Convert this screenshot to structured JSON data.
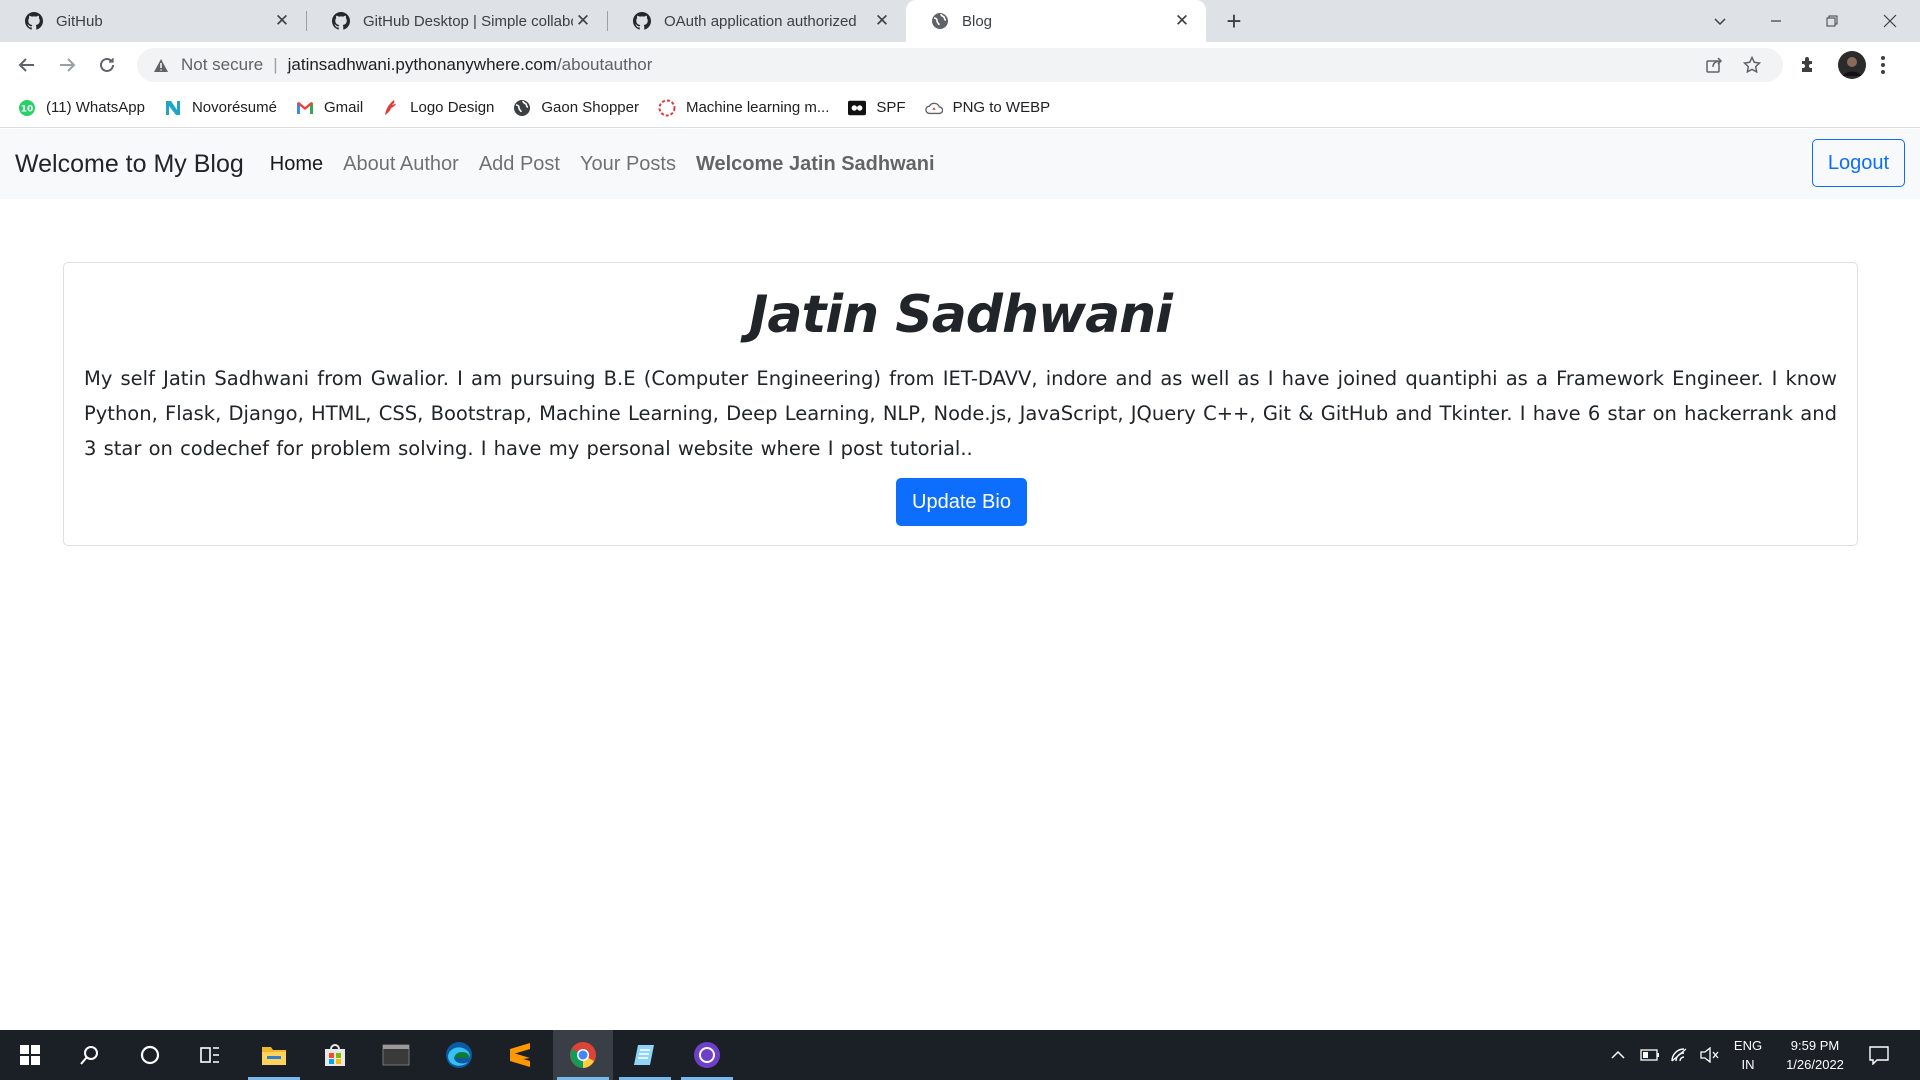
{
  "browser": {
    "tabs": [
      {
        "title": "GitHub",
        "icon": "github-icon",
        "active": false
      },
      {
        "title": "GitHub Desktop | Simple collabor",
        "icon": "github-icon",
        "active": false
      },
      {
        "title": "OAuth application authorized",
        "icon": "github-icon",
        "active": false
      },
      {
        "title": "Blog",
        "icon": "globe-icon",
        "active": true
      }
    ],
    "close_glyph": "✕",
    "new_tab_glyph": "+",
    "address": {
      "security_label": "Not secure",
      "separator": "|",
      "host": "jatinsadhwani.pythonanywhere.com",
      "path": "/aboutauthor"
    },
    "bookmarks": [
      {
        "label": "(11) WhatsApp",
        "icon": "whatsapp-icon"
      },
      {
        "label": "Novorésumé",
        "icon": "novoresume-icon"
      },
      {
        "label": "Gmail",
        "icon": "gmail-icon"
      },
      {
        "label": "Logo Design",
        "icon": "logo-design-icon"
      },
      {
        "label": "Gaon Shopper",
        "icon": "globe-icon"
      },
      {
        "label": "Machine learning m...",
        "icon": "ml-icon"
      },
      {
        "label": "SPF",
        "icon": "spf-icon"
      },
      {
        "label": "PNG to WEBP",
        "icon": "cloud-icon"
      }
    ],
    "whatsapp_badge": "10"
  },
  "site": {
    "brand": "Welcome to My Blog",
    "nav": [
      {
        "label": "Home",
        "active": true
      },
      {
        "label": "About Author",
        "active": false
      },
      {
        "label": "Add Post",
        "active": false
      },
      {
        "label": "Your Posts",
        "active": false
      }
    ],
    "welcome": "Welcome Jatin Sadhwani",
    "logout_label": "Logout"
  },
  "author": {
    "name": "Jatin Sadhwani",
    "bio": "My self Jatin Sadhwani from Gwalior. I am pursuing B.E (Computer Engineering) from IET-DAVV, indore and as well as I have joined quantiphi as a Framework Engineer. I know Python, Flask, Django, HTML, CSS, Bootstrap, Machine Learning, Deep Learning, NLP, Node.js, JavaScript, JQuery C++, Git & GitHub and Tkinter. I have 6 star on hackerrank and 3 star on codechef for problem solving. I have my personal website where I post tutorial..",
    "update_label": "Update Bio"
  },
  "taskbar": {
    "apps": [
      "start-icon",
      "search-icon",
      "cortana-icon",
      "task-view-icon",
      "file-explorer-icon",
      "store-icon",
      "terminal-icon",
      "edge-icon",
      "sublime-text-icon",
      "chrome-icon",
      "notepad-icon",
      "github-desktop-icon"
    ],
    "lang_line1": "ENG",
    "lang_line2": "IN",
    "time": "9:59 PM",
    "date": "1/26/2022"
  },
  "colors": {
    "primary": "#0d6efd",
    "navbar_bg": "#f8f9fa",
    "tabstrip_bg": "#dee1e6",
    "taskbar_bg": "#1b2027"
  }
}
